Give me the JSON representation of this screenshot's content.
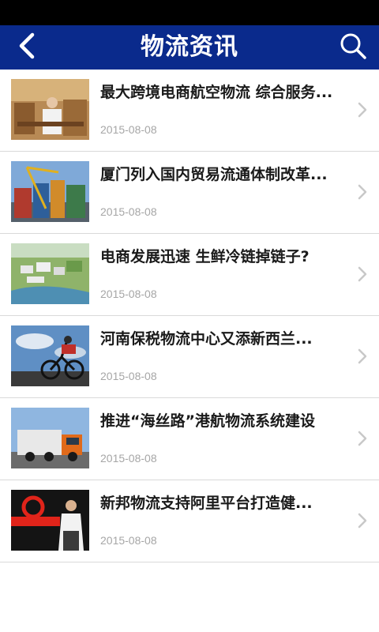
{
  "header": {
    "title": "物流资讯",
    "back_icon": "chevron-left-icon",
    "search_icon": "search-icon",
    "background_color": "#0a2a8c"
  },
  "news": [
    {
      "title": "最大跨境电商航空物流 综合服务...",
      "date": "2015-08-08",
      "thumbnail": "warehouse-worker-photo"
    },
    {
      "title": "厦门列入国内贸易流通体制改革...",
      "date": "2015-08-08",
      "thumbnail": "container-port-photo"
    },
    {
      "title": "电商发展迅速 生鲜冷链掉链子?",
      "date": "2015-08-08",
      "thumbnail": "logistics-park-aerial-photo"
    },
    {
      "title": "河南保税物流中心又添新西兰...",
      "date": "2015-08-08",
      "thumbnail": "cyclist-photo"
    },
    {
      "title": "推进“海丝路”港航物流系统建设",
      "date": "2015-08-08",
      "thumbnail": "truck-photo"
    },
    {
      "title": "新邦物流支持阿里平台打造健...",
      "date": "2015-08-08",
      "thumbnail": "alibaba-speaker-photo"
    }
  ],
  "row_chevron_icon": "chevron-right-icon"
}
